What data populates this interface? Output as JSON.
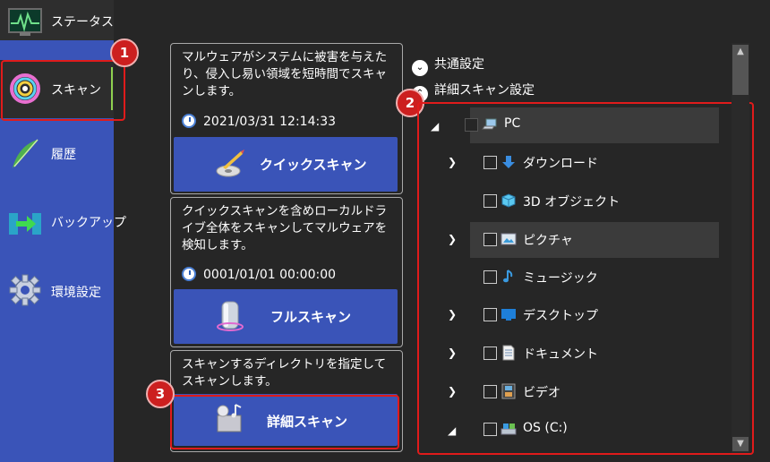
{
  "sidebar": {
    "items": [
      {
        "label": "ステータス",
        "icon": "status-monitor-icon"
      },
      {
        "label": "スキャン",
        "icon": "scan-ring-icon"
      },
      {
        "label": "履歴",
        "icon": "quill-icon"
      },
      {
        "label": "バックアップ",
        "icon": "backup-arrow-icon"
      },
      {
        "label": "環境設定",
        "icon": "gear-icon"
      }
    ],
    "active": "スキャン"
  },
  "callouts": [
    "1",
    "2",
    "3"
  ],
  "quick_scan": {
    "description": "マルウェアがシステムに被害を与えたり、侵入し易い領域を短時間でスキャンします。",
    "date": "2021/03/31 12:14:33",
    "button": "クイックスキャン"
  },
  "full_scan": {
    "description": "クイックスキャンを含めローカルドライブ全体をスキャンしてマルウェアを検知します。",
    "date": "0001/01/01 00:00:00",
    "button": "フルスキャン"
  },
  "custom_scan": {
    "description": "スキャンするディレクトリを指定してスキャンします。",
    "button": "詳細スキャン"
  },
  "settings": {
    "common": "共通設定",
    "detail": "詳細スキャン設定"
  },
  "tree": [
    {
      "label": "PC",
      "icon": "computer-icon"
    },
    {
      "label": "ダウンロード",
      "icon": "download-arrow-icon"
    },
    {
      "label": "3D オブジェクト",
      "icon": "cube-icon"
    },
    {
      "label": "ピクチャ",
      "icon": "picture-icon"
    },
    {
      "label": "ミュージック",
      "icon": "music-note-icon"
    },
    {
      "label": "デスクトップ",
      "icon": "desktop-icon"
    },
    {
      "label": "ドキュメント",
      "icon": "document-icon"
    },
    {
      "label": "ビデオ",
      "icon": "film-icon"
    },
    {
      "label": "OS (C:)",
      "icon": "drive-icon"
    }
  ],
  "colors": {
    "sidebar": "#3a54b8",
    "button": "#3a54b8",
    "background": "#262626",
    "highlight": "#e01b1b"
  }
}
